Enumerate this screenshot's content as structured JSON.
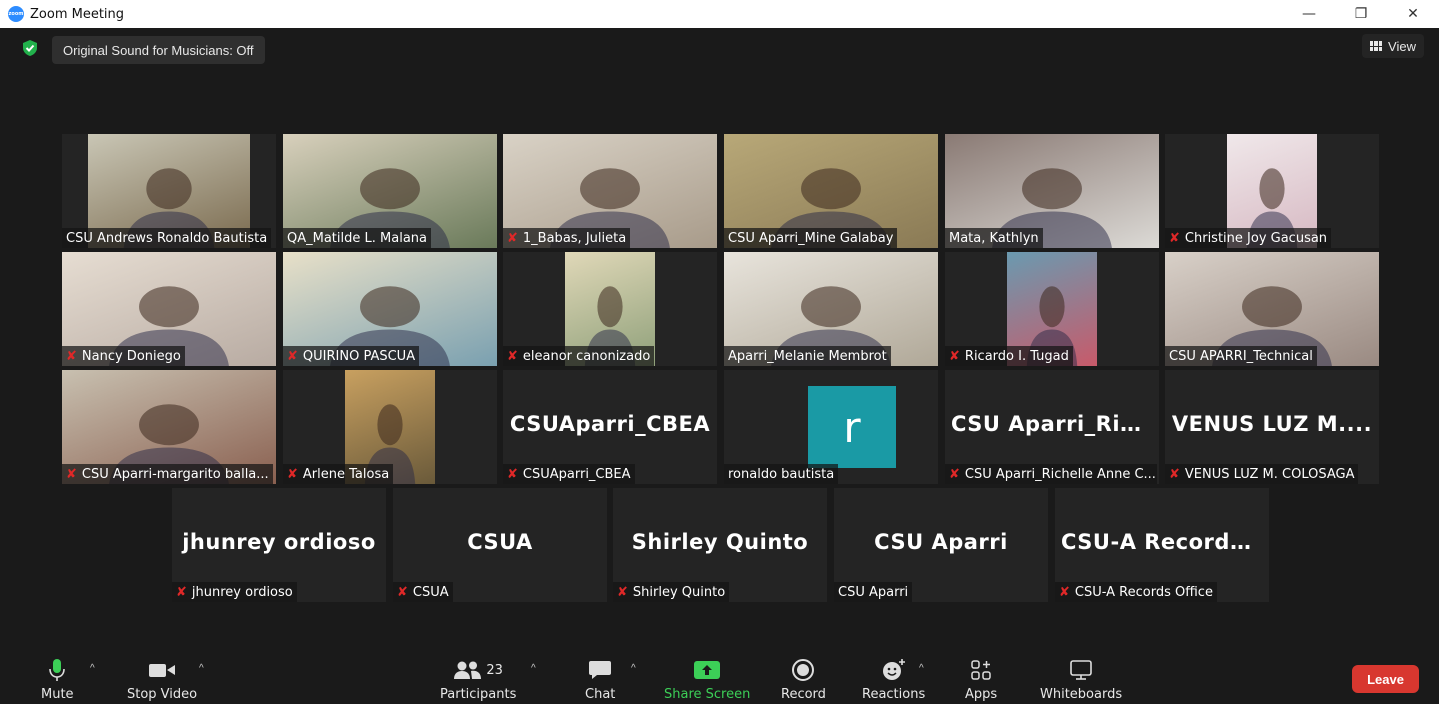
{
  "window": {
    "title": "Zoom Meeting",
    "logo_text": "zoom"
  },
  "top": {
    "sound_label": "Original Sound for Musicians: Off",
    "view_label": "View"
  },
  "tiles": [
    {
      "name": "CSU Andrews Ronaldo Bautista",
      "muted": false,
      "colors": [
        "#7a6a4e",
        "#c9c6b5"
      ]
    },
    {
      "name": "QA_Matilde L. Malana",
      "muted": false,
      "active": true,
      "colors": [
        "#6a7a5a",
        "#d8d0bc"
      ]
    },
    {
      "name": "1_Babas, Julieta",
      "muted": true,
      "colors": [
        "#a89b8a",
        "#d9d2c6"
      ]
    },
    {
      "name": "CSU Aparri_Mine Galabay",
      "muted": false,
      "colors": [
        "#8a7a55",
        "#b8a878"
      ]
    },
    {
      "name": "Mata, Kathlyn",
      "muted": false,
      "colors": [
        "#dcdad6",
        "#8a7a74"
      ]
    },
    {
      "name": "Christine Joy Gacusan",
      "muted": true,
      "colors": [
        "#d6b8c2",
        "#f0e8ea"
      ]
    },
    {
      "name": "Nancy Doniego",
      "muted": true,
      "colors": [
        "#b8aba2",
        "#e6ddd2"
      ]
    },
    {
      "name": "QUIRINO PASCUA",
      "muted": true,
      "colors": [
        "#7aa0b0",
        "#e8e0c8"
      ]
    },
    {
      "name": "eleanor canonizado",
      "muted": true,
      "colors": [
        "#8fa07a",
        "#e0d8b8"
      ]
    },
    {
      "name": "Aparri_Melanie Membrot",
      "muted": false,
      "colors": [
        "#b0a898",
        "#e8e4dc"
      ]
    },
    {
      "name": "Ricardo I. Tugad",
      "muted": true,
      "colors": [
        "#c85a6a",
        "#6a9ab0"
      ]
    },
    {
      "name": "CSU APARRI_Technical",
      "muted": false,
      "colors": [
        "#9a8a82",
        "#d8d0c8"
      ]
    },
    {
      "name": "CSU Aparri-margarito balla...",
      "muted": true,
      "colors": [
        "#8a6050",
        "#c8c0b0"
      ]
    },
    {
      "name": "Arlene Talosa",
      "muted": true,
      "colors": [
        "#6a5a3a",
        "#c8a060"
      ]
    },
    {
      "name": "CSUAparri_CBEA",
      "muted": true,
      "big": "CSUAparri_CBEA"
    },
    {
      "name": "ronaldo bautista",
      "muted": false,
      "avatar": "r"
    },
    {
      "name": "CSU Aparri_Richelle Anne C...",
      "muted": true,
      "big": "CSU  Aparri_Ric..."
    },
    {
      "name": "VENUS LUZ M. COLOSAGA",
      "muted": true,
      "big": "VENUS  LUZ  M...."
    },
    {
      "name": "jhunrey ordioso",
      "muted": true,
      "big": "jhunrey ordioso"
    },
    {
      "name": "CSUA",
      "muted": true,
      "big": "CSUA"
    },
    {
      "name": "Shirley Quinto",
      "muted": true,
      "big": "Shirley Quinto"
    },
    {
      "name": "CSU Aparri",
      "muted": false,
      "big": "CSU Aparri"
    },
    {
      "name": "CSU-A Records Office",
      "muted": true,
      "big": "CSU-A  Records..."
    }
  ],
  "toolbar": {
    "mute": "Mute",
    "stop_video": "Stop Video",
    "participants": "Participants",
    "participants_count": "23",
    "chat": "Chat",
    "share": "Share Screen",
    "record": "Record",
    "reactions": "Reactions",
    "apps": "Apps",
    "whiteboards": "Whiteboards",
    "leave": "Leave"
  },
  "colors": {
    "accent_active": "#c8e56a",
    "share_green": "#3ccf57",
    "leave_red": "#d8372f",
    "zoom_blue": "#2d8cff"
  }
}
